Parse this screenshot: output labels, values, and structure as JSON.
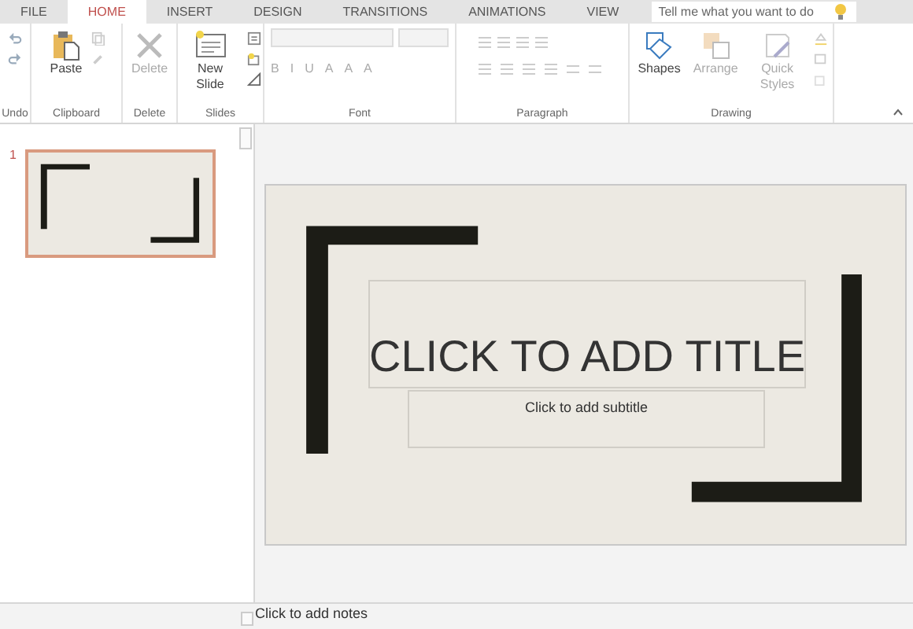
{
  "tabs": [
    {
      "label": "FILE",
      "selected": false
    },
    {
      "label": "HOME",
      "selected": true
    },
    {
      "label": "INSERT",
      "selected": false
    },
    {
      "label": "DESIGN",
      "selected": false
    },
    {
      "label": "TRANSITIONS",
      "selected": false
    },
    {
      "label": "ANIMATIONS",
      "selected": false
    },
    {
      "label": "VIEW",
      "selected": false
    }
  ],
  "tell_me": {
    "placeholder": "Tell me what you want to do"
  },
  "ribbon_groups": [
    {
      "kind": "undo",
      "label": "Undo"
    },
    {
      "kind": "clipboard",
      "label": "Clipboard",
      "buttons": [
        {
          "label": "Paste",
          "disabled": false
        }
      ]
    },
    {
      "kind": "delete",
      "label": "Delete",
      "buttons": [
        {
          "label": "Delete",
          "disabled": true
        }
      ]
    },
    {
      "kind": "slides",
      "label": "Slides",
      "buttons": [
        {
          "label": "New Slide",
          "disabled": false
        }
      ]
    },
    {
      "kind": "font",
      "label": "Font",
      "format_buttons": [
        "B",
        "I",
        "U",
        "A",
        "A",
        "A"
      ]
    },
    {
      "kind": "paragraph",
      "label": "Paragraph"
    },
    {
      "kind": "drawing",
      "label": "Drawing",
      "buttons": [
        {
          "label": "Shapes",
          "disabled": false
        },
        {
          "label": "Arrange",
          "disabled": true
        },
        {
          "label": "Quick Styles",
          "disabled": true
        }
      ]
    }
  ],
  "thumbnails": [
    {
      "number": "1",
      "selected": true
    }
  ],
  "slide": {
    "title_placeholder": "CLICK TO ADD TITLE",
    "subtitle_placeholder": "Click to add subtitle"
  },
  "notes": {
    "placeholder": "Click to add notes"
  }
}
